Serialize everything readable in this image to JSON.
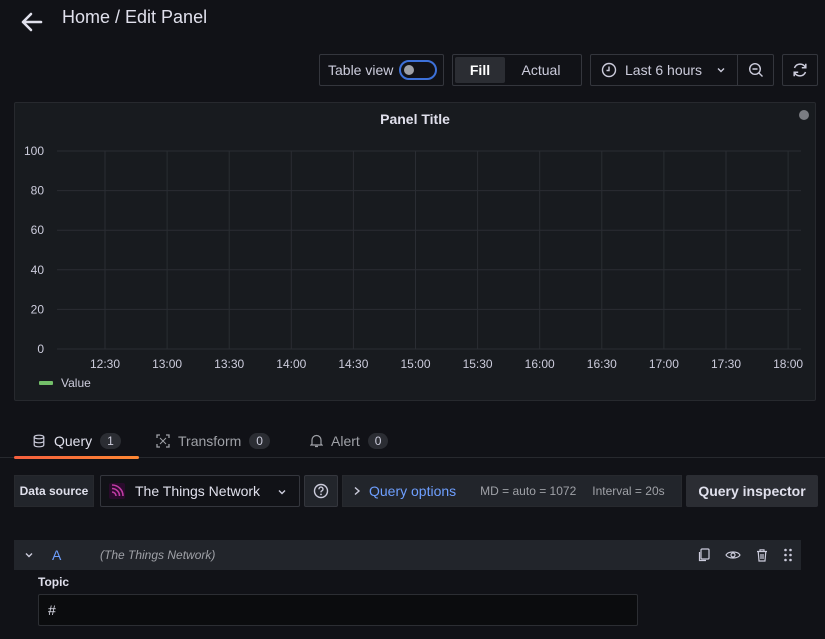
{
  "header": {
    "title": "Home / Edit Panel"
  },
  "toolbar": {
    "table_view_label": "Table view",
    "fill_label": "Fill",
    "actual_label": "Actual",
    "time_range": "Last 6 hours"
  },
  "panel": {
    "title": "Panel Title",
    "legend": "Value"
  },
  "chart_data": {
    "type": "line",
    "title": "Panel Title",
    "x_ticks": [
      "12:30",
      "13:00",
      "13:30",
      "14:00",
      "14:30",
      "15:00",
      "15:30",
      "16:00",
      "16:30",
      "17:00",
      "17:30",
      "18:00"
    ],
    "y_ticks": [
      "0",
      "20",
      "40",
      "60",
      "80",
      "100"
    ],
    "ylim": [
      0,
      100
    ],
    "grid": true,
    "series": [
      {
        "name": "Value",
        "values": [],
        "color": "#73bf69"
      }
    ],
    "legend_position": "bottom-left"
  },
  "tabs": [
    {
      "label": "Query",
      "count": "1"
    },
    {
      "label": "Transform",
      "count": "0"
    },
    {
      "label": "Alert",
      "count": "0"
    }
  ],
  "query_bar": {
    "data_source_label": "Data source",
    "data_source": "The Things Network",
    "query_options_label": "Query options",
    "md": "MD = auto = 1072",
    "interval": "Interval = 20s",
    "inspector_label": "Query inspector"
  },
  "query_row": {
    "letter": "A",
    "datasource": "(The Things Network)",
    "topic_label": "Topic",
    "topic_value": "#"
  },
  "colors": {
    "accent_blue": "#6e9fff",
    "tab_underline": "#ff8833",
    "series_green": "#73bf69"
  }
}
